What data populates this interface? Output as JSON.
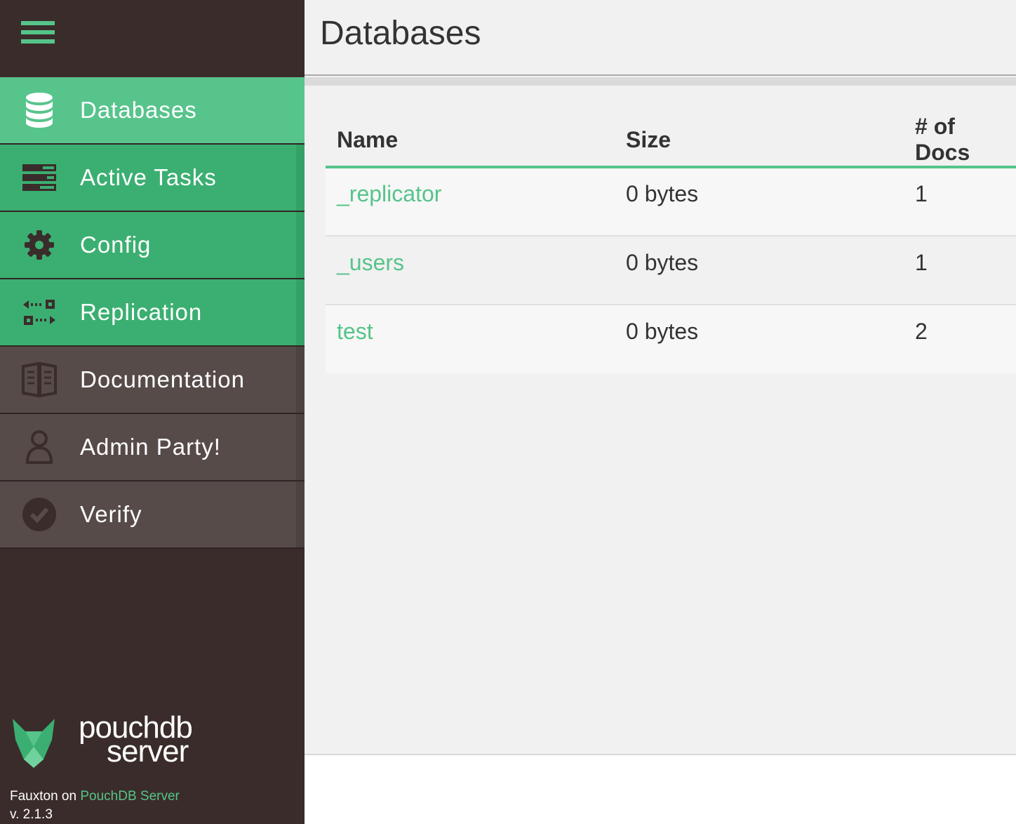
{
  "sidebar": {
    "items": [
      {
        "label": "Databases",
        "icon": "database-icon"
      },
      {
        "label": "Active Tasks",
        "icon": "active-tasks-icon"
      },
      {
        "label": "Config",
        "icon": "gear-icon"
      },
      {
        "label": "Replication",
        "icon": "replication-icon"
      },
      {
        "label": "Documentation",
        "icon": "book-icon"
      },
      {
        "label": "Admin Party!",
        "icon": "user-icon"
      },
      {
        "label": "Verify",
        "icon": "check-circle-icon"
      }
    ],
    "brand": {
      "line1": "pouchdb",
      "line2": "server"
    },
    "footer": {
      "prefix": "Fauxton on",
      "link": "PouchDB Server",
      "version": "v. 2.1.3"
    }
  },
  "header": {
    "title": "Databases"
  },
  "table": {
    "columns": [
      "Name",
      "Size",
      "# of Docs"
    ],
    "rows": [
      {
        "name": "_replicator",
        "size": "0 bytes",
        "docs": "1"
      },
      {
        "name": "_users",
        "size": "0 bytes",
        "docs": "1"
      },
      {
        "name": "test",
        "size": "0 bytes",
        "docs": "2"
      }
    ]
  },
  "colors": {
    "accent": "#56c48a",
    "sidebar": "#3a2c2b",
    "nav_green": "#3baf71",
    "nav_gray": "#564b49"
  }
}
